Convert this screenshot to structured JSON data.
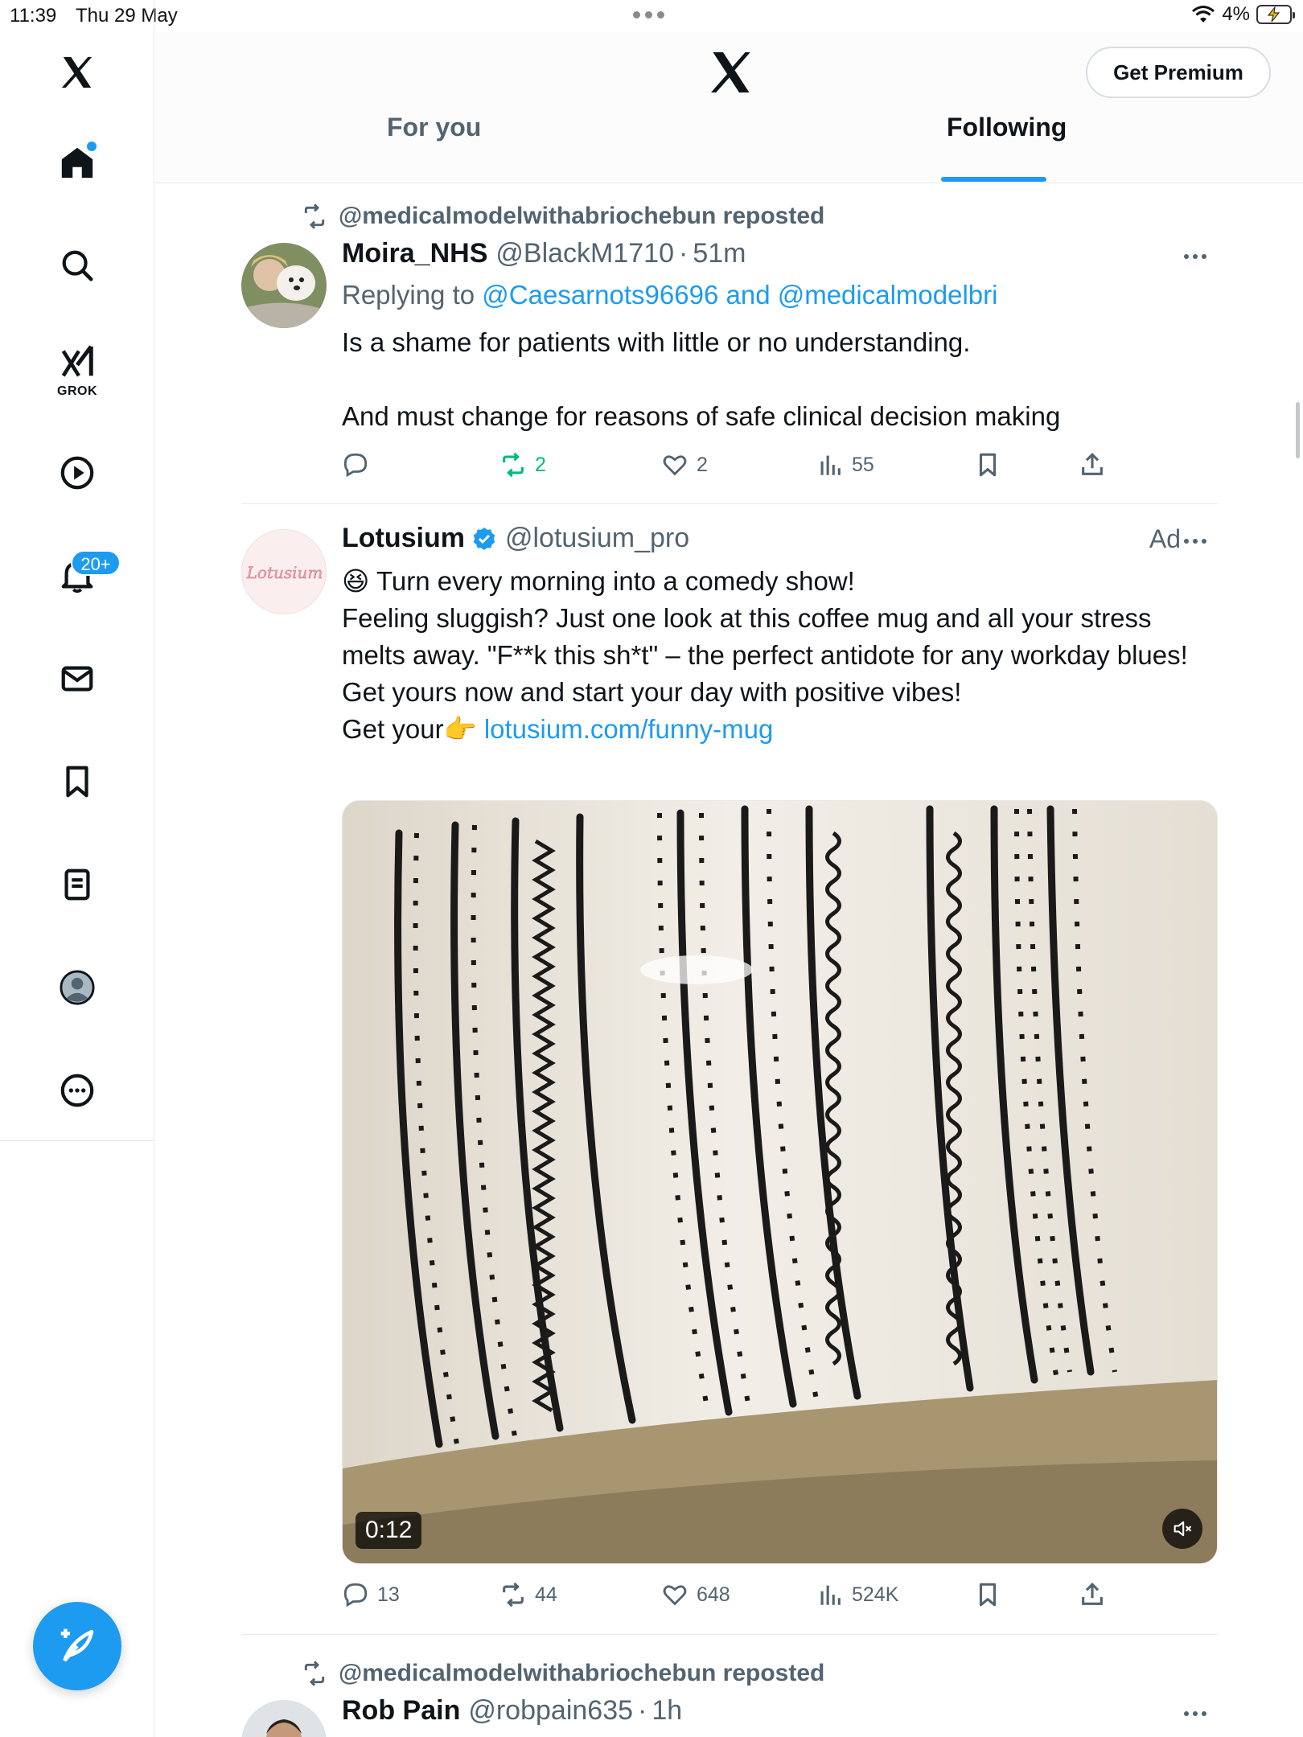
{
  "status_bar": {
    "time": "11:39",
    "date": "Thu 29 May",
    "battery": "4%"
  },
  "sidebar": {
    "items": [
      {
        "name": "home",
        "icon": "home-icon"
      },
      {
        "name": "explore",
        "icon": "search-icon"
      },
      {
        "name": "grok",
        "icon": "grok-icon",
        "label": "GROK"
      },
      {
        "name": "videos",
        "icon": "play-icon"
      },
      {
        "name": "notifications",
        "icon": "bell-icon",
        "badge": "20+"
      },
      {
        "name": "messages",
        "icon": "mail-icon"
      },
      {
        "name": "bookmarks",
        "icon": "bookmark-icon"
      },
      {
        "name": "lists",
        "icon": "list-icon"
      },
      {
        "name": "profile",
        "icon": "profile-icon"
      },
      {
        "name": "more",
        "icon": "more-circle-icon"
      }
    ],
    "compose_icon": "compose-feather-icon"
  },
  "header": {
    "premium_label": "Get Premium",
    "tabs": [
      {
        "label": "For you",
        "active": false
      },
      {
        "label": "Following",
        "active": true
      }
    ]
  },
  "tweets": [
    {
      "repost_text": "@medicalmodelwithabriochebun reposted",
      "name": "Moira_NHS",
      "handle": "@BlackM1710",
      "time": "51m",
      "reply_prefix": "Replying to",
      "reply_mention_1": "@Caesarnots96696",
      "reply_and": "and",
      "reply_mention_2": "@medicalmodelbri",
      "text_line_1": "Is a shame for patients with little or no understanding.",
      "text_line_2": "And must change for reasons of safe clinical decision making",
      "stats": {
        "replies": "",
        "reposts": "2",
        "likes": "2",
        "views": "55"
      }
    },
    {
      "name": "Lotusium",
      "handle": "@lotusium_pro",
      "ad_label": "Ad",
      "avatar_text": "Lotusium",
      "emoji_1": "😆",
      "text_line_1": "Turn every morning into a comedy show!",
      "text_line_2": "Feeling sluggish? Just one look at this coffee mug and all your stress melts away. \"F**k this sh*t\" – the perfect antidote for any workday blues!",
      "text_line_3": "Get yours now and start your day with positive vibes!",
      "text_line_4_prefix": "Get your",
      "emoji_2": "👉",
      "link": "lotusium.com/funny-mug",
      "video_duration": "0:12",
      "stats": {
        "replies": "13",
        "reposts": "44",
        "likes": "648",
        "views": "524K"
      }
    },
    {
      "repost_text": "@medicalmodelwithabriochebun reposted",
      "name": "Rob Pain",
      "handle": "@robpain635",
      "time": "1h"
    }
  ],
  "colors": {
    "accent": "#1d9bf0",
    "text_primary": "#0f1419",
    "text_secondary": "#536471",
    "repost_green": "#00ba7c"
  }
}
